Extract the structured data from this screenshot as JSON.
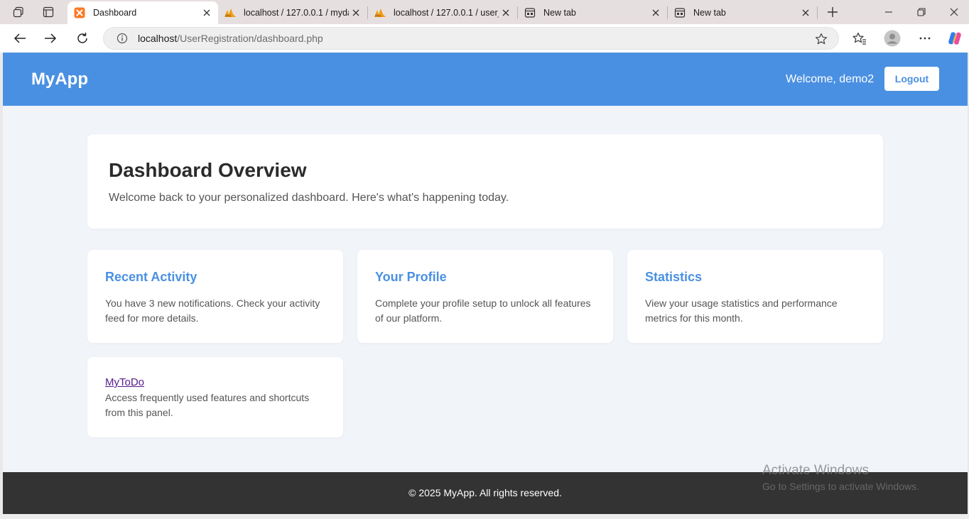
{
  "browser": {
    "tabs": [
      {
        "title": "Dashboard",
        "icon": "xampp-icon",
        "active": true
      },
      {
        "title": "localhost / 127.0.0.1 / mydat",
        "icon": "phpmyadmin-icon",
        "active": false
      },
      {
        "title": "localhost / 127.0.0.1 / user_a",
        "icon": "phpmyadmin-icon",
        "active": false
      },
      {
        "title": "New tab",
        "icon": "new-tab-icon",
        "active": false
      },
      {
        "title": "New tab",
        "icon": "new-tab-icon",
        "active": false
      }
    ],
    "address": {
      "host": "localhost",
      "path": "/UserRegistration/dashboard.php"
    }
  },
  "app": {
    "brand": "MyApp",
    "welcome": "Welcome, demo2",
    "logout_label": "Logout",
    "header_color": "#4a90e2"
  },
  "overview": {
    "title": "Dashboard Overview",
    "subtitle": "Welcome back to your personalized dashboard. Here's what's happening today."
  },
  "cards": [
    {
      "title": "Recent Activity",
      "text": "You have 3 new notifications. Check your activity feed for more details."
    },
    {
      "title": "Your Profile",
      "text": "Complete your profile setup to unlock all features of our platform."
    },
    {
      "title": "Statistics",
      "text": "View your usage statistics and performance metrics for this month."
    }
  ],
  "todo_card": {
    "link": "MyToDo",
    "text": "Access frequently used features and shortcuts from this panel."
  },
  "footer": {
    "text": "© 2025 MyApp. All rights reserved."
  },
  "watermark": {
    "line1": "Activate Windows",
    "line2": "Go to Settings to activate Windows."
  }
}
